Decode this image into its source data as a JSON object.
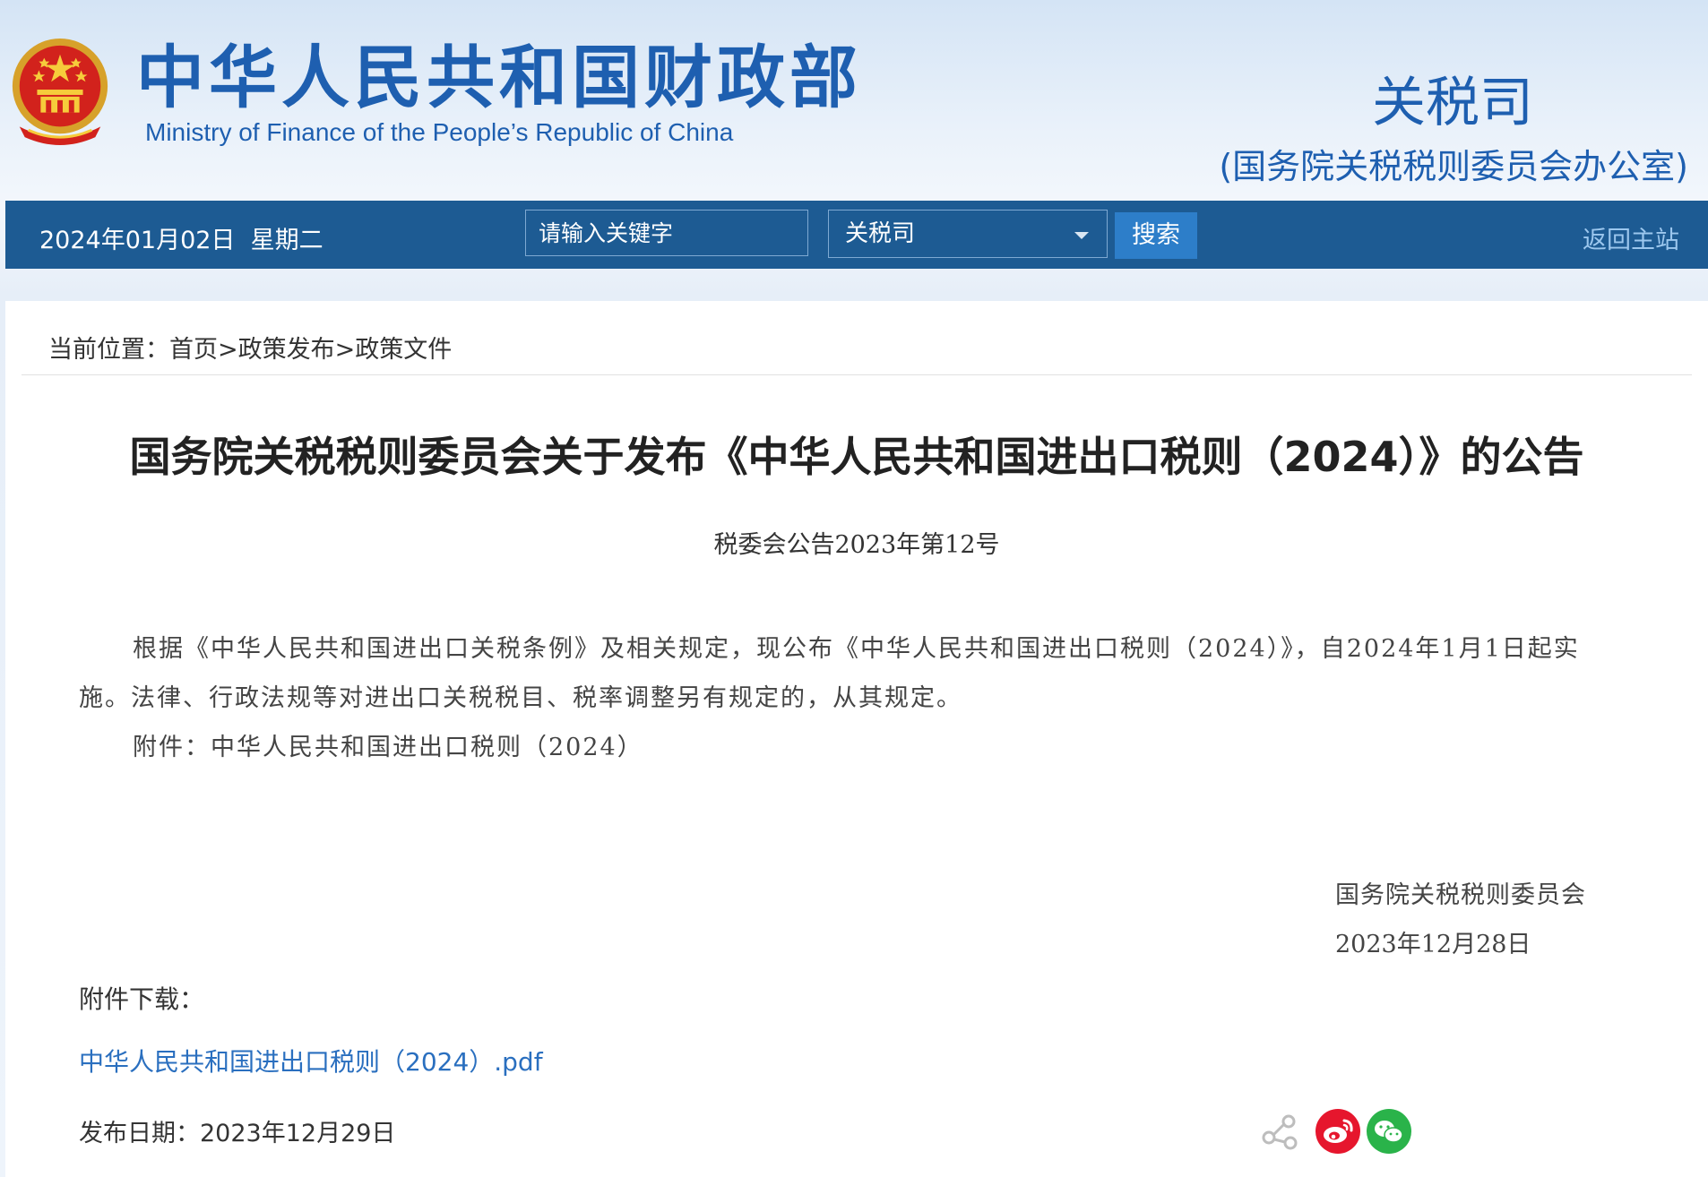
{
  "header": {
    "ministry_cn": "中华人民共和国财政部",
    "ministry_en": "Ministry of Finance of the People’s Republic of China",
    "department": "关税司",
    "department_sub": "(国务院关税税则委员会办公室)"
  },
  "navbar": {
    "date": "2024年01月02日",
    "weekday": "星期二",
    "search_placeholder": "请输入关键字",
    "scope_selected": "关税司",
    "search_button": "搜索",
    "home_link": "返回主站"
  },
  "breadcrumb": {
    "prefix": "当前位置：",
    "items": [
      "首页",
      "政策发布",
      "政策文件"
    ],
    "separator": ">"
  },
  "article": {
    "title": "国务院关税税则委员会关于发布《中华人民共和国进出口税则（2024）》的公告",
    "doc_number": "税委会公告2023年第12号",
    "para_1_line_1": "根据《中华人民共和国进出口关税条例》及相关规定，现公布《中华人民共和国进出口税则（2024）》，自2024年1月1日起实",
    "para_1_line_2": "施。法律、行政法规等对进出口关税税目、税率调整另有规定的，从其规定。",
    "attachment_line": "附件：中华人民共和国进出口税则（2024）",
    "signature_org": "国务院关税税则委员会",
    "signature_date": "2023年12月28日"
  },
  "downloads": {
    "label": "附件下载：",
    "file_name": "中华人民共和国进出口税则（2024）.pdf"
  },
  "footer": {
    "publish_date_label": "发布日期：",
    "publish_date": "2023年12月29日"
  },
  "share": {
    "icons": [
      "share-icon",
      "weibo-icon",
      "wechat-icon"
    ],
    "colors": {
      "weibo": "#e6162d",
      "wechat": "#2ab34a",
      "share": "#bdbdbd"
    }
  },
  "colors": {
    "nav_background": "#1d5b93",
    "brand_blue": "#1e5fb0",
    "search_button": "#2d7ec9",
    "link": "#2a6fbf"
  }
}
